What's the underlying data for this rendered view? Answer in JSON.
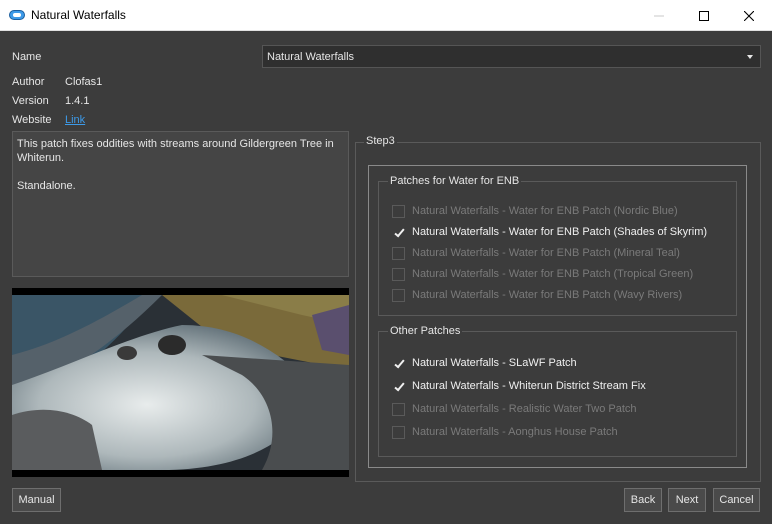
{
  "window": {
    "title": "Natural Waterfalls"
  },
  "fields": {
    "name_label": "Name",
    "name_value": "Natural Waterfalls",
    "author_label": "Author",
    "author_value": "Clofas1",
    "version_label": "Version",
    "version_value": "1.4.1",
    "website_label": "Website",
    "website_link": "Link"
  },
  "description": {
    "line1": "This patch fixes oddities with streams around Gildergreen Tree in",
    "line2": "Whiterun.",
    "line3": "Standalone."
  },
  "step": {
    "title": "Step3",
    "groups": [
      {
        "title": "Patches for Water for ENB",
        "options": [
          {
            "label": "Natural Waterfalls - Water for ENB Patch (Nordic Blue)",
            "checked": false,
            "enabled": false
          },
          {
            "label": "Natural Waterfalls - Water for ENB Patch (Shades of Skyrim)",
            "checked": true,
            "enabled": true
          },
          {
            "label": "Natural Waterfalls - Water for ENB Patch (Mineral Teal)",
            "checked": false,
            "enabled": false
          },
          {
            "label": "Natural Waterfalls - Water for ENB Patch (Tropical Green)",
            "checked": false,
            "enabled": false
          },
          {
            "label": "Natural Waterfalls - Water for ENB Patch (Wavy Rivers)",
            "checked": false,
            "enabled": false
          }
        ]
      },
      {
        "title": "Other Patches",
        "options": [
          {
            "label": "Natural Waterfalls - SLaWF Patch",
            "checked": true,
            "enabled": true
          },
          {
            "label": "Natural Waterfalls - Whiterun District Stream Fix",
            "checked": true,
            "enabled": true
          },
          {
            "label": "Natural Waterfalls - Realistic Water Two Patch",
            "checked": false,
            "enabled": false
          },
          {
            "label": "Natural Waterfalls - Aonghus House Patch",
            "checked": false,
            "enabled": false
          }
        ]
      }
    ]
  },
  "buttons": {
    "manual": "Manual",
    "back": "Back",
    "next": "Next",
    "cancel": "Cancel"
  },
  "colors": {
    "background": "#3c3c3c",
    "link": "#3d9ae8",
    "titlebar": "#ffffff",
    "app_icon": "#3d9ae8"
  }
}
